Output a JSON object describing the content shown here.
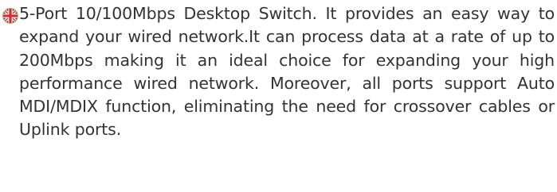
{
  "description": {
    "icon": "uk-flag-icon",
    "text": "5-Port 10/100Mbps Desktop Switch. It provides an easy way to expand your wired network.It can pro­cess data at a rate of up to 200Mbps making it an ide­al choice for expanding your high performance wired network. Moreover, all ports support Auto MDI/MDIX function, eliminating the need for crossover cables or Uplink ports."
  }
}
